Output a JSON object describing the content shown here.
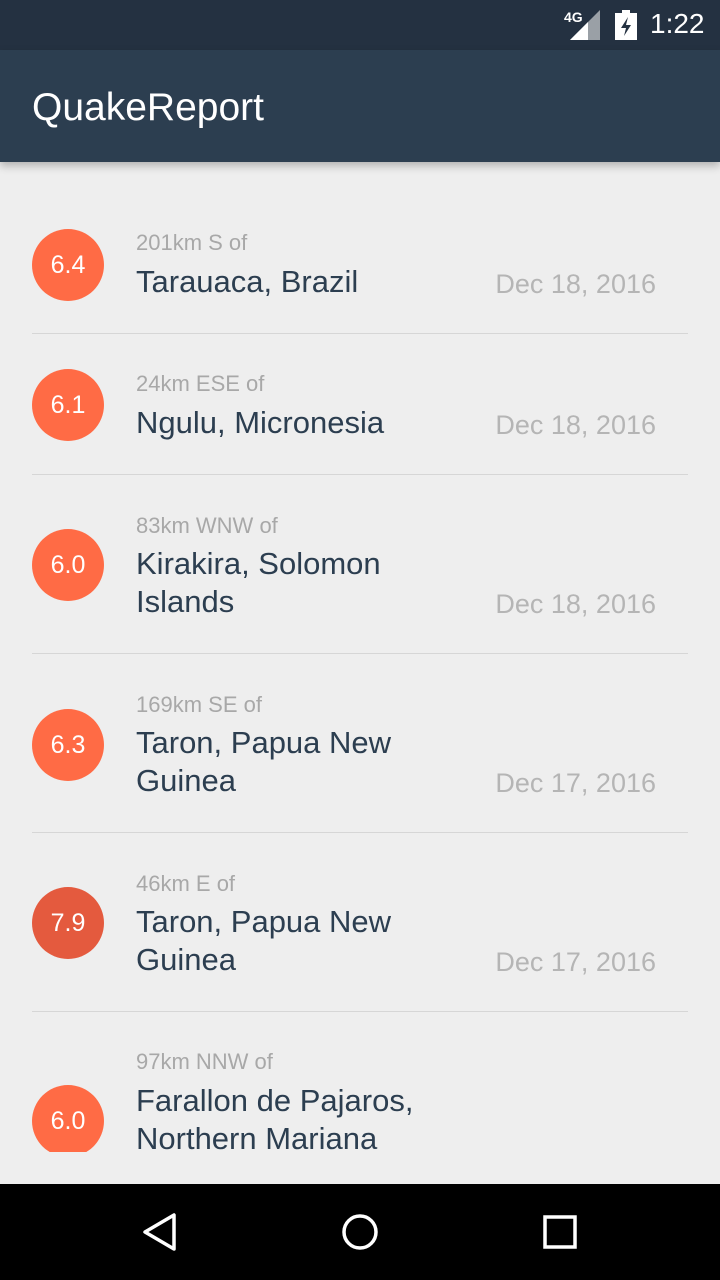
{
  "status_bar": {
    "network": "4G",
    "time": "1:22",
    "icons": [
      "signal-icon",
      "battery-icon"
    ]
  },
  "app": {
    "title": "QuakeReport",
    "colors": {
      "app_bar": "#2c3e50",
      "status_bar": "#243141",
      "background": "#eeeeee",
      "magnitude_default": "#ff6b45",
      "magnitude_strong": "#e45a3e"
    }
  },
  "earthquakes": [
    {
      "magnitude": "6.4",
      "offset": "201km S of",
      "place": "Tarauaca, Brazil",
      "date": "Dec 18, 2016"
    },
    {
      "magnitude": "6.1",
      "offset": "24km ESE of",
      "place": "Ngulu, Micronesia",
      "date": "Dec 18, 2016"
    },
    {
      "magnitude": "6.0",
      "offset": "83km WNW of",
      "place": "Kirakira, Solomon Islands",
      "date": "Dec 18, 2016"
    },
    {
      "magnitude": "6.3",
      "offset": "169km SE of",
      "place": "Taron, Papua New Guinea",
      "date": "Dec 17, 2016"
    },
    {
      "magnitude": "7.9",
      "offset": "46km E of",
      "place": "Taron, Papua New Guinea",
      "date": "Dec 17, 2016"
    },
    {
      "magnitude": "6.0",
      "offset": "97km NNW of",
      "place": "Farallon de Pajaros, Northern Mariana",
      "date": ""
    }
  ],
  "nav_bar": {
    "icons": [
      "back-icon",
      "home-icon",
      "recents-icon"
    ]
  }
}
